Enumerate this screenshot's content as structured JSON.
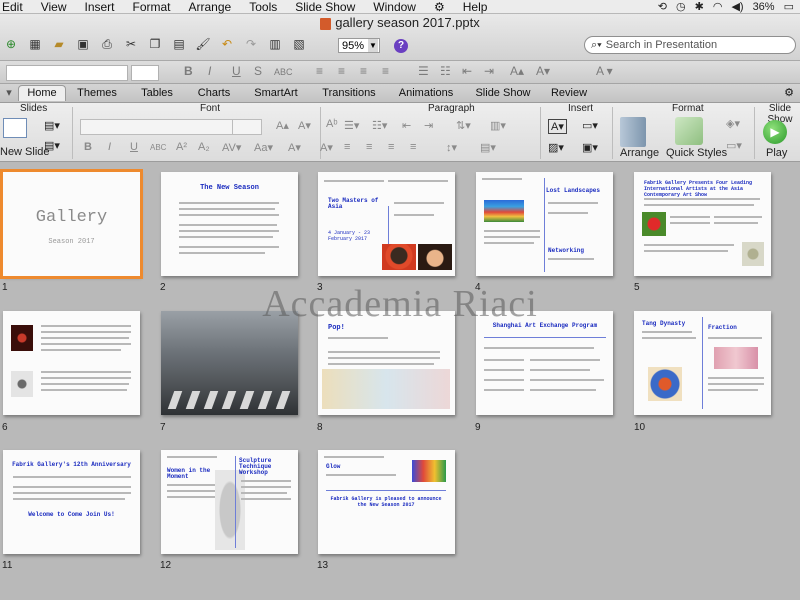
{
  "menubar": {
    "items": [
      "Edit",
      "View",
      "Insert",
      "Format",
      "Arrange",
      "Tools",
      "Slide Show",
      "Window",
      "Help"
    ],
    "battery": "36%"
  },
  "window": {
    "title": "gallery season 2017.pptx",
    "zoom": "95%",
    "search_placeholder": "Search in Presentation"
  },
  "ribbon": {
    "tabs": [
      "Home",
      "Themes",
      "Tables",
      "Charts",
      "SmartArt",
      "Transitions",
      "Animations",
      "Slide Show",
      "Review"
    ],
    "active_tab": "Home",
    "groups": {
      "slides": "Slides",
      "font": "Font",
      "paragraph": "Paragraph",
      "insert": "Insert",
      "format": "Format",
      "slideshow": "Slide Show"
    },
    "new_slide": "New Slide",
    "arrange": "Arrange",
    "quick_styles": "Quick Styles",
    "play": "Play"
  },
  "watermark": "Accademia Riaci",
  "slides": [
    {
      "num": "1",
      "title": "Gallery",
      "subtitle": "Season 2017",
      "selected": true
    },
    {
      "num": "2",
      "title": "The New Season"
    },
    {
      "num": "3",
      "title": "Two Masters of Asia",
      "subtitle": "4 January - 23 February 2017"
    },
    {
      "num": "4",
      "title": "Lost Landscapes",
      "subtitle": "Networking"
    },
    {
      "num": "5",
      "title": "Fabrik Gallery Presents Four Leading International Artists at the Asia Contemporary Art Show"
    },
    {
      "num": "6"
    },
    {
      "num": "7"
    },
    {
      "num": "8",
      "title": "Pop!"
    },
    {
      "num": "9",
      "title": "Shanghai Art Exchange Program"
    },
    {
      "num": "10",
      "title": "Tang Dynasty",
      "subtitle": "Fraction"
    },
    {
      "num": "11",
      "title": "Fabrik Gallery's 12th Anniversary",
      "subtitle": "Welcome to Come Join Us!"
    },
    {
      "num": "12",
      "title": "Sculpture Technique Workshop",
      "subtitle": "Women in the Moment"
    },
    {
      "num": "13",
      "title": "Glow",
      "subtitle": "Fabrik Gallery is pleased to announce the New Season 2017"
    }
  ],
  "colors": {
    "selection": "#ee8a2e",
    "slide_text": "#1a2bbf"
  }
}
